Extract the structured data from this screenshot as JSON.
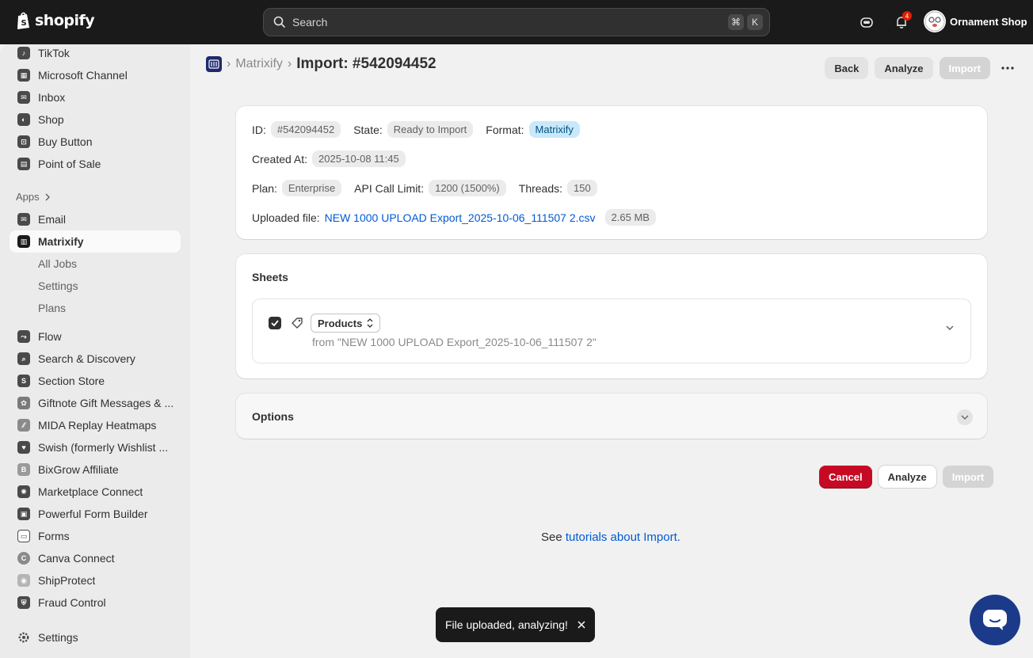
{
  "topbar": {
    "logo_text": "shopify",
    "search_placeholder": "Search",
    "shortcut_keys": [
      "⌘",
      "K"
    ],
    "notification_count": "4",
    "store_name": "Ornament Shop"
  },
  "sidebar": {
    "channels": [
      {
        "label": "TikTok",
        "icon": "tiktok-icon"
      },
      {
        "label": "Microsoft Channel",
        "icon": "microsoft-icon"
      },
      {
        "label": "Inbox",
        "icon": "inbox-icon"
      },
      {
        "label": "Shop",
        "icon": "shop-icon"
      },
      {
        "label": "Buy Button",
        "icon": "buy-button-icon"
      },
      {
        "label": "Point of Sale",
        "icon": "pos-icon"
      }
    ],
    "apps_label": "Apps",
    "apps": [
      {
        "label": "Email",
        "icon": "email-icon"
      },
      {
        "label": "Matrixify",
        "icon": "matrixify-icon",
        "active": true
      }
    ],
    "matrixify_sub": [
      "All Jobs",
      "Settings",
      "Plans"
    ],
    "more_apps": [
      {
        "label": "Flow",
        "icon": "flow-icon"
      },
      {
        "label": "Search & Discovery",
        "icon": "search-discovery-icon"
      },
      {
        "label": "Section Store",
        "icon": "section-store-icon"
      },
      {
        "label": "Giftnote Gift Messages & ...",
        "icon": "giftnote-icon"
      },
      {
        "label": "MIDA Replay Heatmaps",
        "icon": "mida-icon"
      },
      {
        "label": "Swish (formerly Wishlist ...",
        "icon": "swish-icon"
      },
      {
        "label": "BixGrow Affiliate",
        "icon": "bixgrow-icon"
      },
      {
        "label": "Marketplace Connect",
        "icon": "marketplace-icon"
      },
      {
        "label": "Powerful Form Builder",
        "icon": "form-builder-icon"
      },
      {
        "label": "Forms",
        "icon": "forms-icon"
      },
      {
        "label": "Canva Connect",
        "icon": "canva-icon"
      },
      {
        "label": "ShipProtect",
        "icon": "shipprotect-icon"
      },
      {
        "label": "Fraud Control",
        "icon": "fraud-control-icon"
      }
    ],
    "settings_label": "Settings"
  },
  "header": {
    "crumb_app": "Matrixify",
    "title": "Import: #542094452",
    "back_label": "Back",
    "analyze_label": "Analyze",
    "import_label": "Import"
  },
  "details": {
    "id_label": "ID:",
    "id_value": "#542094452",
    "state_label": "State:",
    "state_value": "Ready to Import",
    "format_label": "Format:",
    "format_value": "Matrixify",
    "created_label": "Created At:",
    "created_value": "2025-10-08 11:45",
    "plan_label": "Plan:",
    "plan_value": "Enterprise",
    "api_label": "API Call Limit:",
    "api_value": "1200 (1500%)",
    "threads_label": "Threads:",
    "threads_value": "150",
    "uploaded_label": "Uploaded file:",
    "uploaded_file": "NEW 1000 UPLOAD Export_2025-10-06_111507 2.csv",
    "file_size": "2.65 MB"
  },
  "sheets": {
    "title": "Sheets",
    "sheet_type": "Products",
    "sheet_source": "from \"NEW 1000 UPLOAD Export_2025-10-06_111507 2\""
  },
  "options": {
    "title": "Options"
  },
  "footer": {
    "cancel_label": "Cancel",
    "analyze_label": "Analyze",
    "import_label": "Import",
    "tutorial_prefix": "See ",
    "tutorial_link": "tutorials about Import",
    "tutorial_suffix": "."
  },
  "toast": {
    "message": "File uploaded, analyzing!"
  },
  "colors": {
    "topbar": "#1a1a1a",
    "cancel": "#c70a24",
    "link": "#005bd3",
    "chat_fab": "#1b3a8a"
  }
}
